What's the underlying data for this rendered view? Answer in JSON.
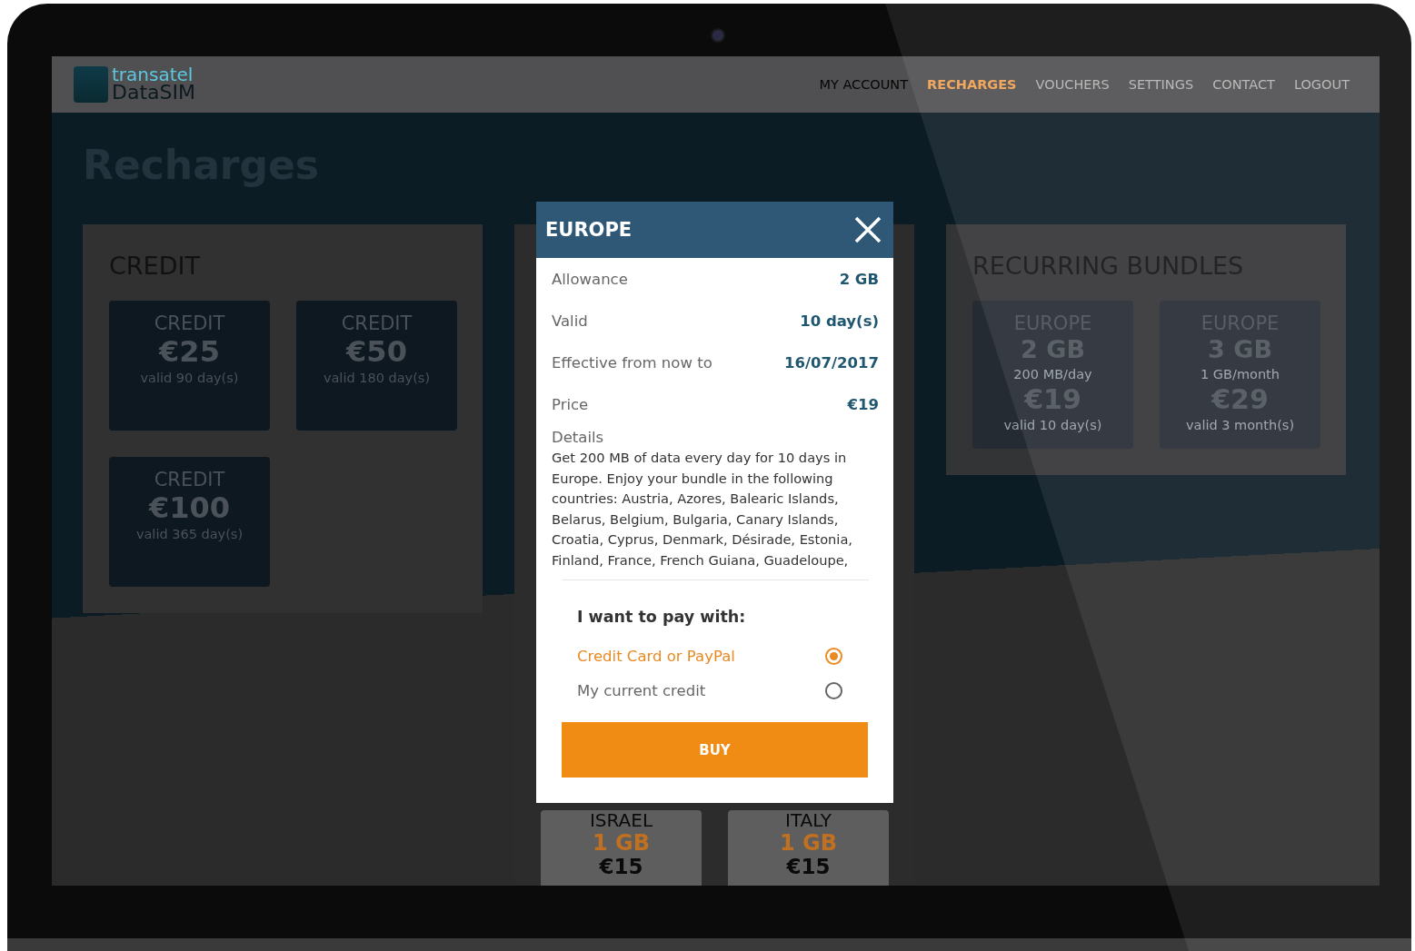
{
  "header": {
    "logo_top": "transatel",
    "logo_bottom": "DataSIM",
    "nav": [
      {
        "label": "MY ACCOUNT",
        "selected": false
      },
      {
        "label": "RECHARGES",
        "selected": true
      },
      {
        "label": "VOUCHERS",
        "selected": false
      },
      {
        "label": "SETTINGS",
        "selected": false
      },
      {
        "label": "CONTACT",
        "selected": false
      },
      {
        "label": "LOGOUT",
        "selected": false
      }
    ]
  },
  "page_title": "Recharges",
  "credit_panel": {
    "title": "CREDIT",
    "cards": [
      {
        "label": "CREDIT",
        "amount": "€25",
        "validity": "valid 90 day(s)"
      },
      {
        "label": "CREDIT",
        "amount": "€50",
        "validity": "valid 180 day(s)"
      },
      {
        "label": "CREDIT",
        "amount": "€100",
        "validity": "valid 365 day(s)"
      }
    ]
  },
  "bundles_panel": {
    "cards": [
      {
        "country": "ISRAEL",
        "allowance": "1 GB",
        "price": "€15"
      },
      {
        "country": "ITALY",
        "allowance": "1 GB",
        "price": "€15"
      }
    ]
  },
  "recurring_panel": {
    "title": "RECURRING BUNDLES",
    "cards": [
      {
        "label": "EUROPE",
        "allowance": "2 GB",
        "rate": "200 MB/day",
        "price": "€19",
        "validity": "valid 10 day(s)"
      },
      {
        "label": "EUROPE",
        "allowance": "3 GB",
        "rate": "1 GB/month",
        "price": "€29",
        "validity": "valid 3 month(s)"
      }
    ]
  },
  "modal": {
    "title": "EUROPE",
    "rows": [
      {
        "label": "Allowance",
        "value": "2 GB"
      },
      {
        "label": "Valid",
        "value": "10 day(s)"
      },
      {
        "label": "Effective from now to",
        "value": "16/07/2017"
      },
      {
        "label": "Price",
        "value": "€19"
      }
    ],
    "details_label": "Details",
    "details_text": "Get 200 MB of data every day for 10 days in Europe. Enjoy your bundle in the following countries: Austria, Azores, Balearic Islands, Belarus, Belgium, Bulgaria, Canary Islands, Croatia, Cyprus, Denmark, Désirade, Estonia, Finland, France, French Guiana, Guadeloupe,",
    "pay_title": "I want to pay with:",
    "options": [
      {
        "label": "Credit Card or PayPal",
        "selected": true
      },
      {
        "label": "My current credit",
        "selected": false
      }
    ],
    "buy_label": "BUY"
  }
}
